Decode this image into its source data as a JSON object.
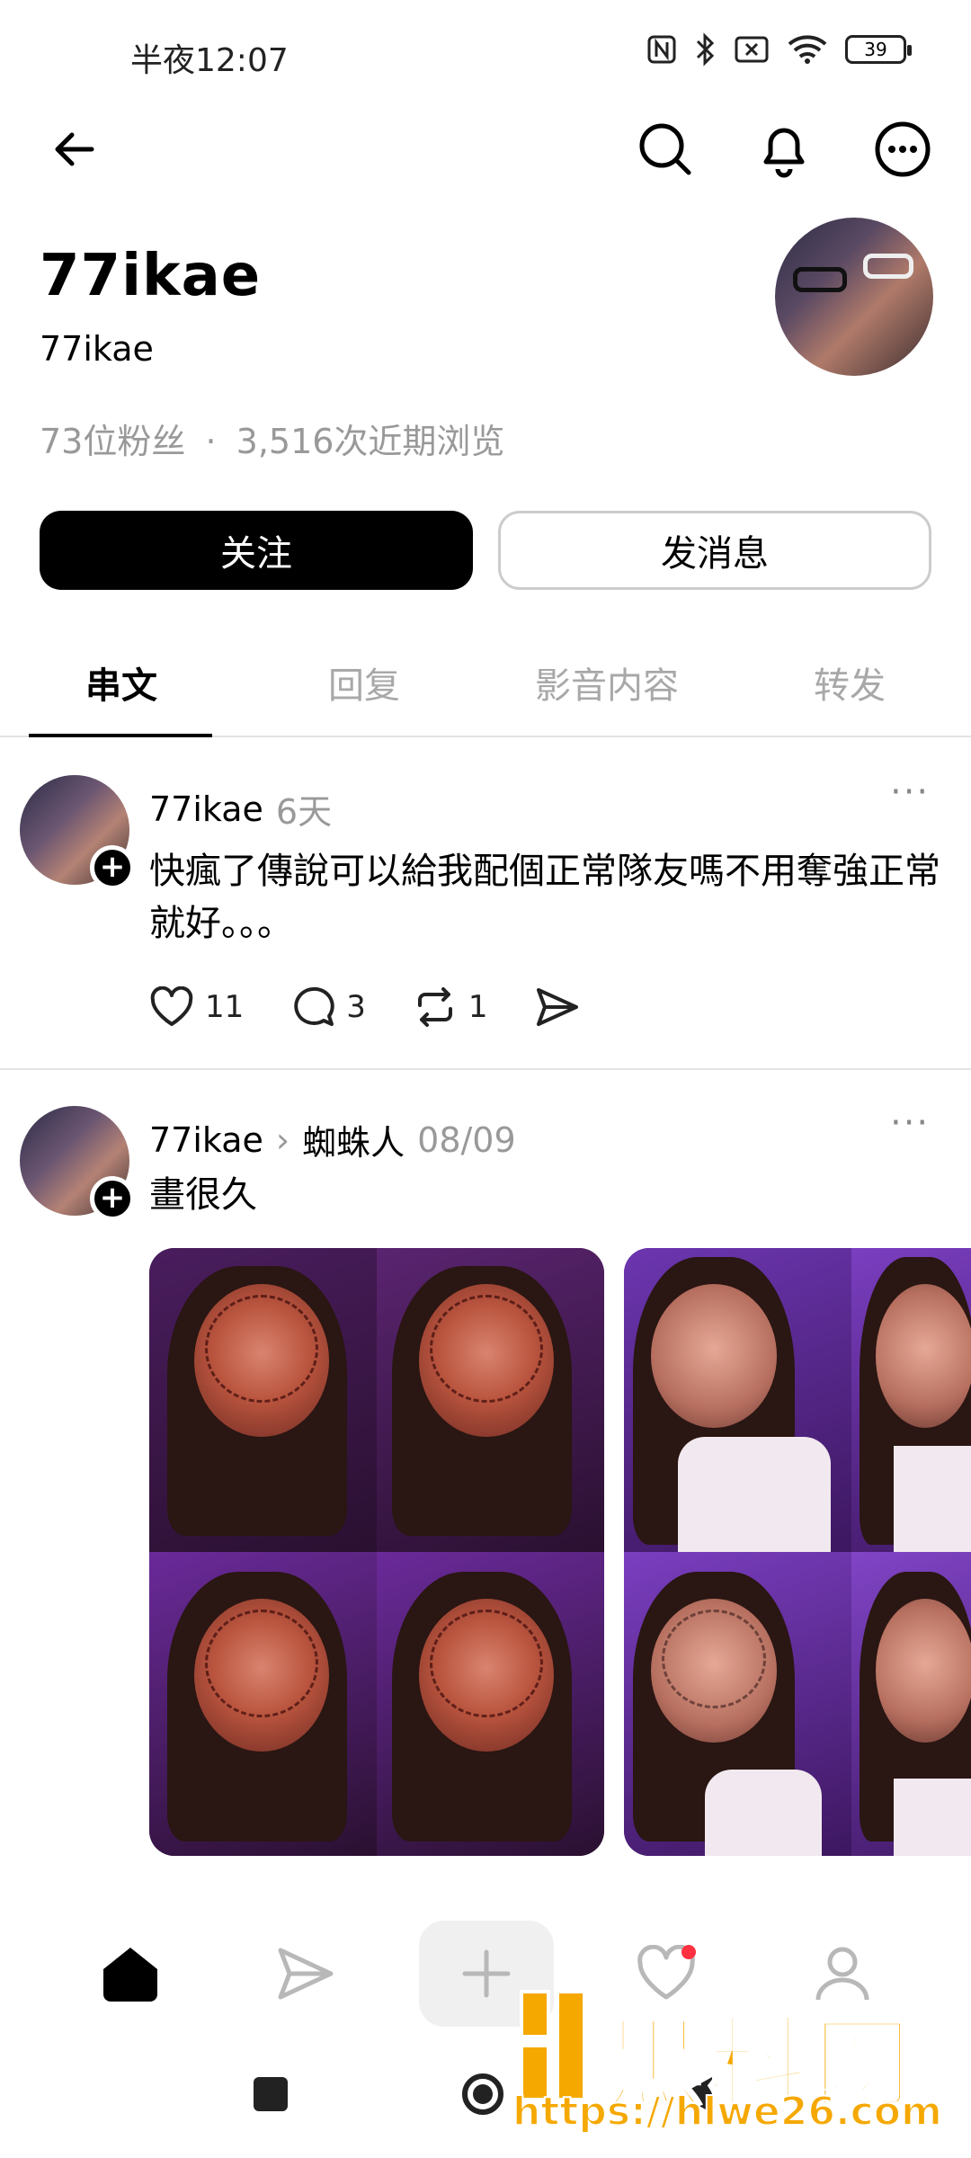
{
  "status_bar": {
    "time": "半夜12:07",
    "battery": "39"
  },
  "top_bar": {
    "back_icon": "arrow-left-icon",
    "search_icon": "search-icon",
    "bell_icon": "bell-icon",
    "more_icon": "more-circle-icon"
  },
  "profile": {
    "name": "77ikae",
    "handle": "77ikae",
    "followers": "73位粉丝",
    "separator": "·",
    "views": "3,516次近期浏览",
    "follow_label": "关注",
    "message_label": "发消息"
  },
  "tabs": [
    {
      "label": "串文",
      "active": true
    },
    {
      "label": "回复",
      "active": false
    },
    {
      "label": "影音内容",
      "active": false
    },
    {
      "label": "转发",
      "active": false
    }
  ],
  "posts": [
    {
      "user": "77ikae",
      "time": "6天",
      "text": "快瘋了傳說可以給我配個正常隊友嗎不用奪強正常就好。。。",
      "likes": "11",
      "comments": "3",
      "reposts": "1",
      "more": "···"
    },
    {
      "user": "77ikae",
      "topic": "蜘蛛人",
      "time": "08/09",
      "text": "畫很久",
      "more": "···"
    }
  ],
  "bottom_nav": {
    "home": "home-icon",
    "send": "send-icon",
    "new_post": "plus-icon",
    "activity": "heart-icon",
    "profile": "person-icon"
  },
  "watermark": {
    "title": "黑料网",
    "url": "https://hlwe26.com"
  },
  "colors": {
    "accent": "#000000",
    "muted": "#999999",
    "watermark": "#f5a800"
  }
}
